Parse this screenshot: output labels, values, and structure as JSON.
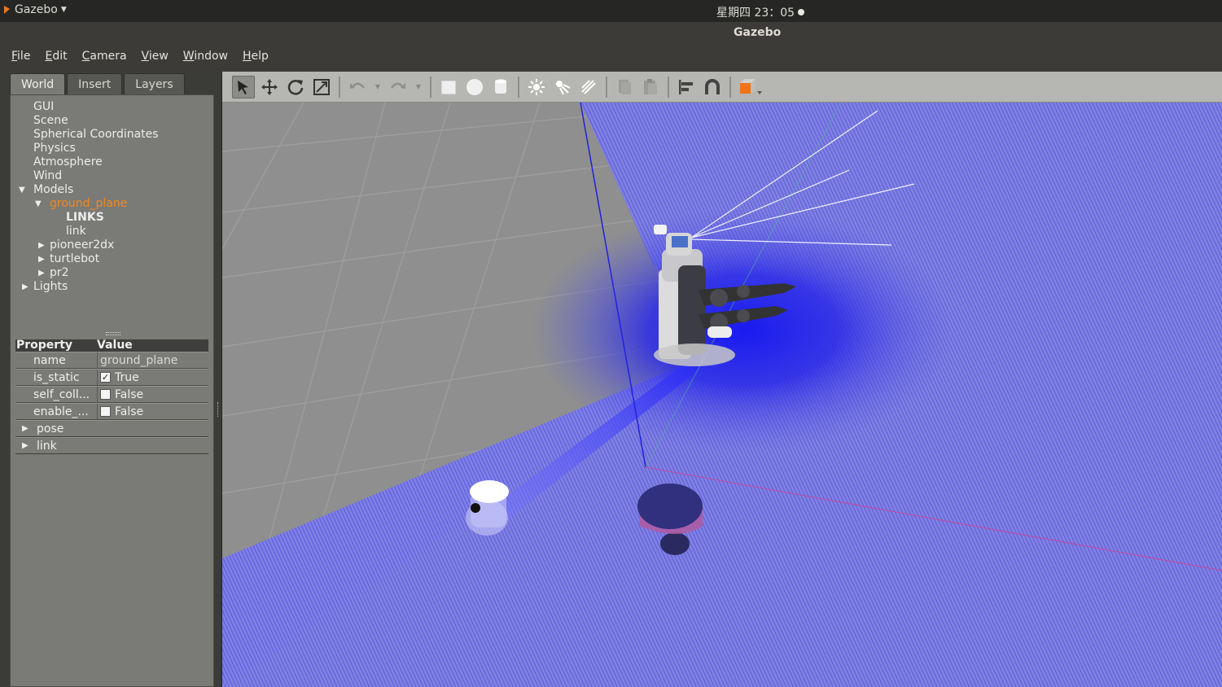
{
  "topbar": {
    "app_name": "Gazebo",
    "clock": "星期四 23：05"
  },
  "window": {
    "title": "Gazebo"
  },
  "menu": [
    {
      "first": "F",
      "rest": "ile"
    },
    {
      "first": "E",
      "rest": "dit"
    },
    {
      "first": "C",
      "rest": "amera"
    },
    {
      "first": "V",
      "rest": "iew"
    },
    {
      "first": "W",
      "rest": "indow"
    },
    {
      "first": "H",
      "rest": "elp"
    }
  ],
  "tabs": {
    "world": "World",
    "insert": "Insert",
    "layers": "Layers"
  },
  "tree": {
    "gui": "GUI",
    "scene": "Scene",
    "spherical": "Spherical Coordinates",
    "physics": "Physics",
    "atmosphere": "Atmosphere",
    "wind": "Wind",
    "models": "Models",
    "ground_plane": "ground_plane",
    "links_header": "LINKS",
    "link": "link",
    "pioneer": "pioneer2dx",
    "turtlebot": "turtlebot",
    "pr2": "pr2",
    "lights": "Lights"
  },
  "properties": {
    "col_property": "Property",
    "col_value": "Value",
    "name_key": "name",
    "name_value": "ground_plane",
    "static_key": "is_static",
    "static_value": "True",
    "selfcoll_key": "self_coll...",
    "selfcoll_value": "False",
    "enable_key": "enable_...",
    "enable_value": "False",
    "pose": "pose",
    "link": "link"
  },
  "toolbar_icons": [
    "select-arrow-icon",
    "translate-icon",
    "rotate-icon",
    "scale-icon",
    "undo-icon",
    "redo-icon",
    "box-icon",
    "sphere-icon",
    "cylinder-icon",
    "point-light-icon",
    "spot-light-icon",
    "directional-light-icon",
    "copy-icon",
    "paste-icon",
    "align-icon",
    "snap-icon",
    "view-angle-icon"
  ],
  "colors": {
    "selected": "#f08a20",
    "laser": "#3a3aee",
    "ground": "#8f8f8f"
  }
}
